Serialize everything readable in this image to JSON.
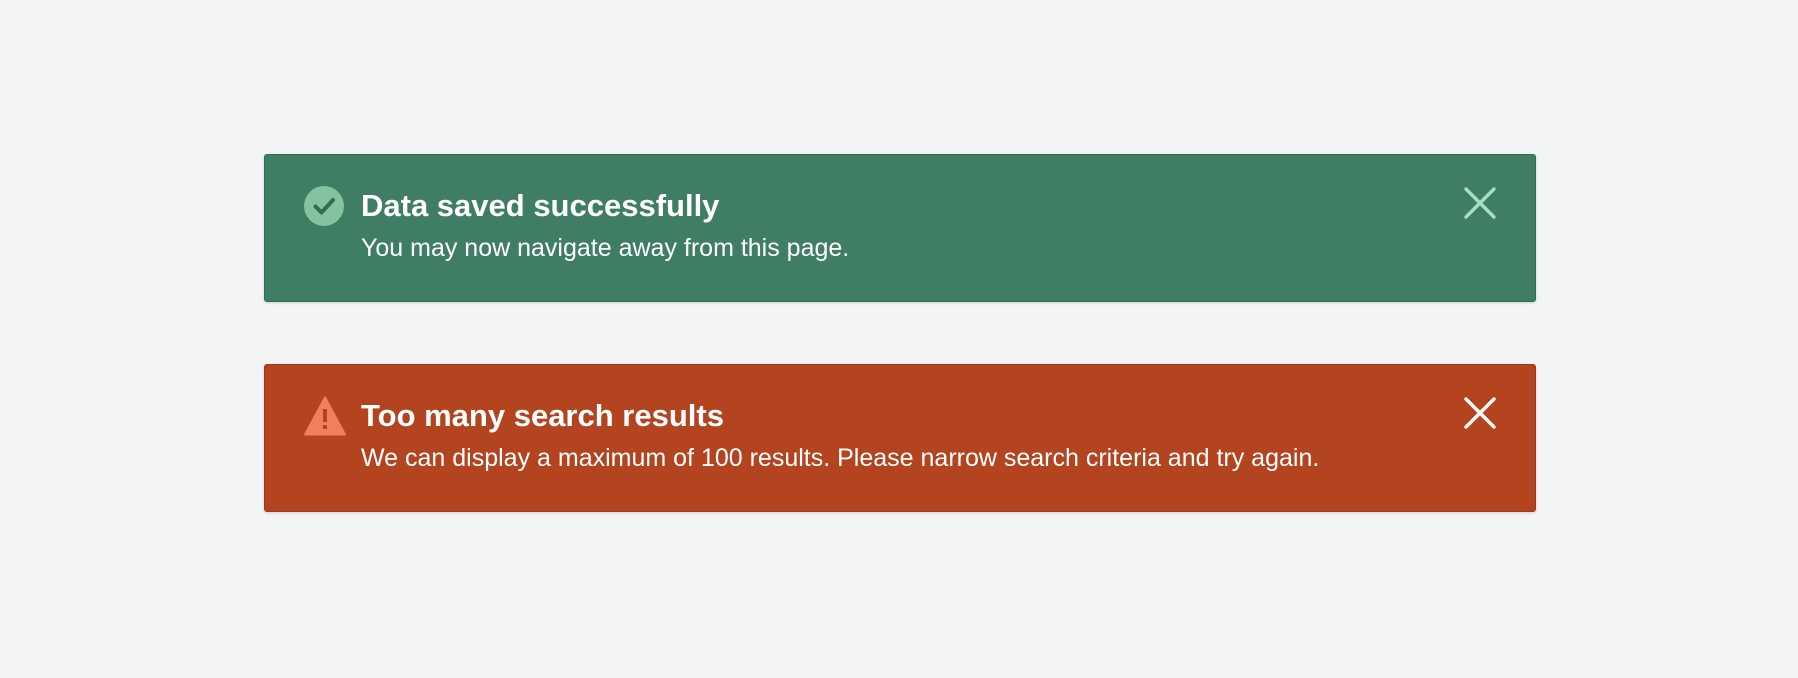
{
  "alerts": [
    {
      "type": "success",
      "icon": "check-circle-icon",
      "title": "Data saved successfully",
      "message": "You may now navigate away from this page.",
      "background": "#3f7e65",
      "icon_color": "#84c39e",
      "close_color": "#a7e0bc"
    },
    {
      "type": "error",
      "icon": "warning-triangle-icon",
      "title": "Too many search results",
      "message": "We can display a maximum of 100 results. Please narrow search criteria and try again.",
      "background": "#b44320",
      "icon_color": "#ef7f5f",
      "close_color": "#ffffff"
    }
  ]
}
